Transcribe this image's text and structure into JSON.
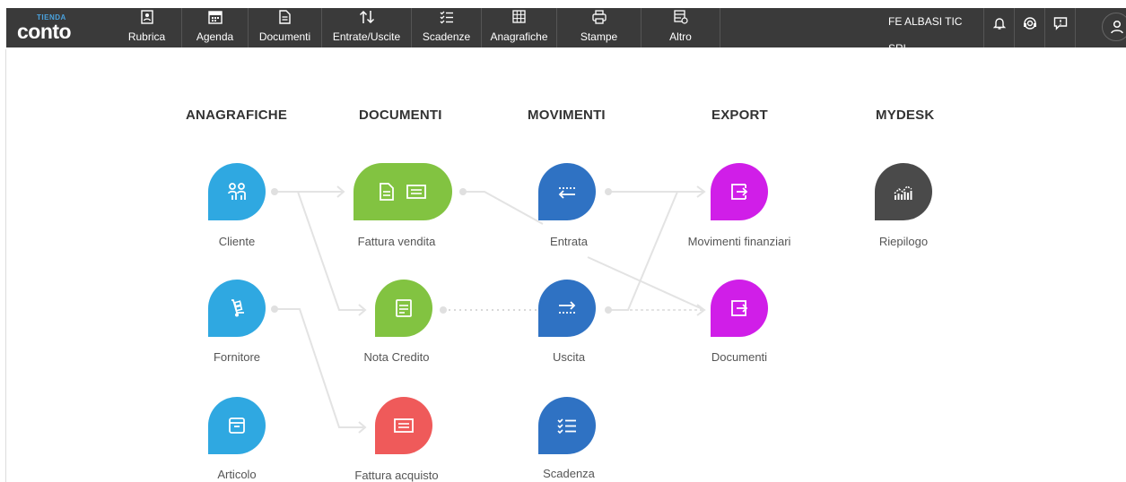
{
  "nav": {
    "logo_small": "TIENDA",
    "logo_big": "conto",
    "items": [
      {
        "label": "Rubrica",
        "icon": "address-book-icon"
      },
      {
        "label": "Agenda",
        "icon": "calendar-icon"
      },
      {
        "label": "Documenti",
        "icon": "document-icon"
      },
      {
        "label": "Entrate/Uscite",
        "icon": "arrows-updown-icon"
      },
      {
        "label": "Scadenze",
        "icon": "checklist-icon"
      },
      {
        "label": "Anagrafiche",
        "icon": "grid-icon"
      },
      {
        "label": "Stampe",
        "icon": "printer-icon"
      },
      {
        "label": "Altro",
        "icon": "more-icon"
      }
    ],
    "company": "FE ALBASI TIC SRL"
  },
  "columns": {
    "anagrafiche": "ANAGRAFICHE",
    "documenti": "DOCUMENTI",
    "movimenti": "MOVIMENTI",
    "export": "EXPORT",
    "mydesk": "MYDESK"
  },
  "tiles": {
    "cliente": "Cliente",
    "fornitore": "Fornitore",
    "articolo": "Articolo",
    "fattura_vendita": "Fattura vendita",
    "nota_credito": "Nota Credito",
    "fattura_acquisto": "Fattura acquisto",
    "entrata": "Entrata",
    "uscita": "Uscita",
    "scadenza": "Scadenza",
    "movimenti_finanziari": "Movimenti finanziari",
    "documenti": "Documenti",
    "riepilogo": "Riepilogo"
  },
  "colors": {
    "topbar": "#3a3a3a",
    "anagrafiche": "#2fa8e1",
    "documenti_green": "#82c341",
    "documenti_red": "#ef5a5a",
    "movimenti": "#2f72c3",
    "export": "#d01ee8",
    "mydesk": "#4a4a4a"
  }
}
